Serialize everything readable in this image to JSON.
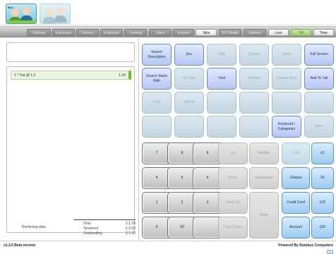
{
  "users": [
    {
      "name": "Bob",
      "active": true
    },
    {
      "name": "",
      "active": false
    }
  ],
  "toolbar": {
    "buttons": [
      "Delivery",
      "Expenses",
      "Delivery",
      "Expenses",
      "Training",
      "Stock",
      "Enquiry",
      "Tabs",
      "X/Z Reads",
      "Options",
      "Lock",
      "Till",
      "Time"
    ]
  },
  "left": {
    "items": [
      {
        "text": "1 * Tea @ 1.2",
        "price": "1.20"
      }
    ],
    "status": "Retrieving data",
    "totals": [
      {
        "label": "Total",
        "value": "£ 1.20"
      },
      {
        "label": "Tendered",
        "value": "£ 0.00"
      },
      {
        "label": "Outstanding",
        "value": "£ 1.20"
      }
    ]
  },
  "functions": {
    "row1": [
      "Search Description",
      "Esc",
      "Quit",
      "Cancel",
      "Class",
      "Full Screen"
    ],
    "row2": [
      "Search Starts With",
      "No Sale",
      "Void",
      "Reprint",
      "Change Price",
      "Add To Tab"
    ],
    "row3": [
      "Staff",
      "Staff %",
      "",
      "",
      "",
      ""
    ],
    "row4": [
      "",
      "",
      "",
      "",
      "Keyboard / Categories",
      "More"
    ]
  },
  "keypad": {
    "row1": [
      "7",
      "8",
      "9",
      "Up"
    ],
    "row2": [
      "4",
      "5",
      "6",
      "Down"
    ],
    "row3": [
      "1",
      "2",
      "3",
      "Page Up"
    ],
    "row4": [
      "0",
      "00",
      ".",
      "Page Down"
    ],
    "multiply": "Multiply",
    "backspace": "Backspace",
    "enter": "Enter"
  },
  "payments": {
    "row1": [
      "Cash",
      "£1"
    ],
    "row2": [
      "Cheque",
      "£5"
    ],
    "row3": [
      "Credit Card",
      "£10"
    ],
    "row4": [
      "Account",
      "£20"
    ]
  },
  "footer": {
    "version": "v1.2.6 Beta version",
    "powered": "Powered By Rombus Computers"
  }
}
